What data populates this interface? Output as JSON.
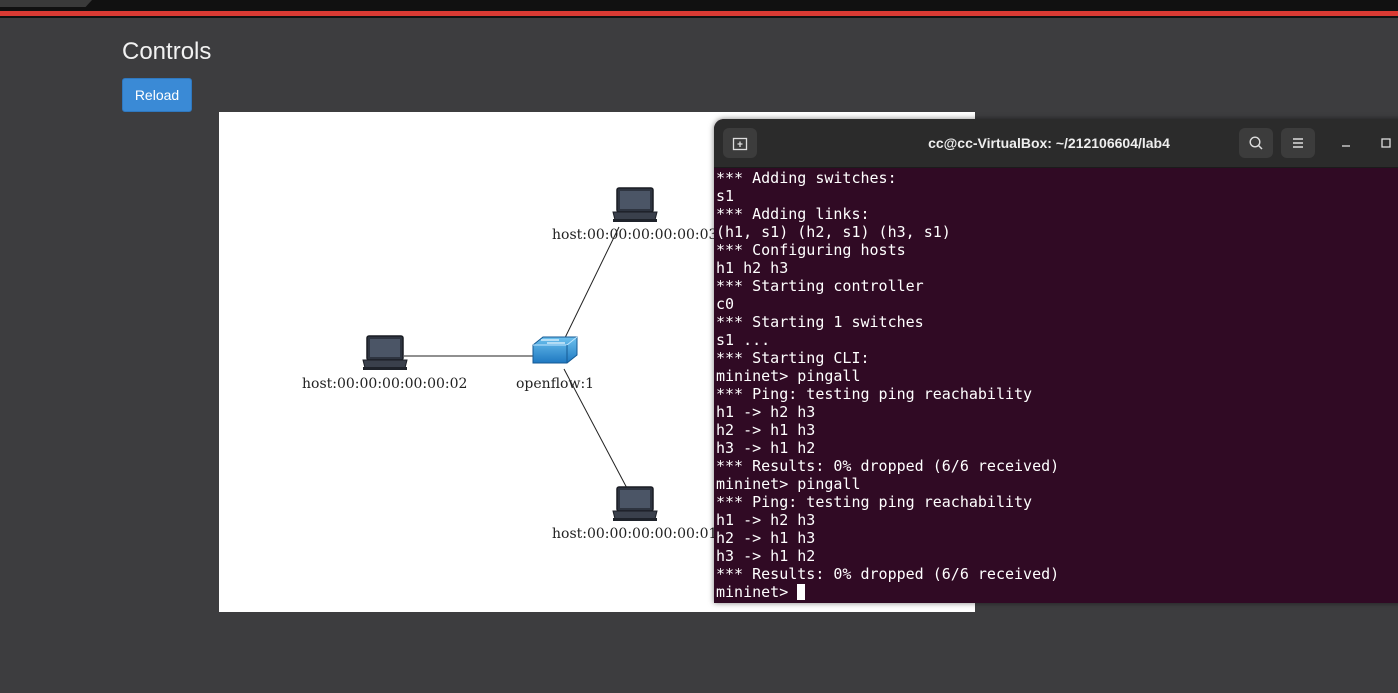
{
  "controls": {
    "title": "Controls",
    "reload_label": "Reload"
  },
  "topology": {
    "nodes": [
      {
        "id": "h3",
        "label": "host:00:00:00:00:00:03",
        "kind": "host"
      },
      {
        "id": "h2",
        "label": "host:00:00:00:00:00:02",
        "kind": "host"
      },
      {
        "id": "s1",
        "label": "openflow:1",
        "kind": "switch"
      },
      {
        "id": "h1",
        "label": "host:00:00:00:00:00:01",
        "kind": "host"
      }
    ]
  },
  "terminal": {
    "title": "cc@cc-VirtualBox: ~/212106604/lab4",
    "background": "#300a24",
    "lines": [
      "*** Adding switches:",
      "s1",
      "*** Adding links:",
      "(h1, s1) (h2, s1) (h3, s1)",
      "*** Configuring hosts",
      "h1 h2 h3",
      "*** Starting controller",
      "c0",
      "*** Starting 1 switches",
      "s1 ...",
      "*** Starting CLI:",
      "mininet> pingall",
      "*** Ping: testing ping reachability",
      "h1 -> h2 h3",
      "h2 -> h1 h3",
      "h3 -> h1 h2",
      "*** Results: 0% dropped (6/6 received)",
      "mininet> pingall",
      "*** Ping: testing ping reachability",
      "h1 -> h2 h3",
      "h2 -> h1 h3",
      "h3 -> h1 h2",
      "*** Results: 0% dropped (6/6 received)"
    ],
    "prompt": "mininet>"
  },
  "colors": {
    "accent_red": "#d93a33",
    "button_blue": "#3a8ad6",
    "page_bg": "#3d3d3f"
  }
}
